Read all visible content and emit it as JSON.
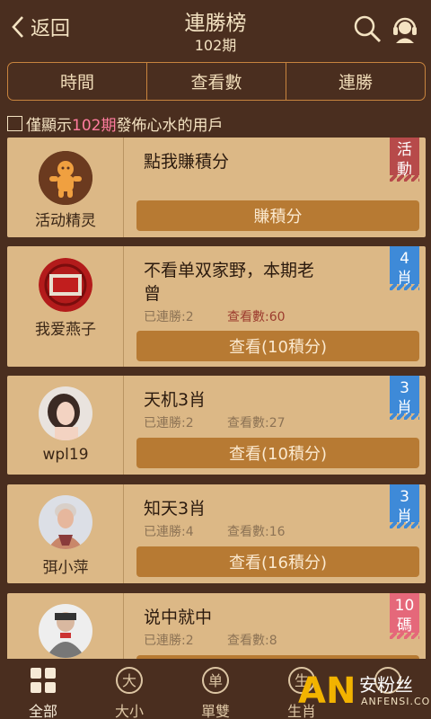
{
  "header": {
    "back_label": "返回",
    "title": "連勝榜",
    "period": "102期"
  },
  "tabs": [
    {
      "label": "時間"
    },
    {
      "label": "查看數"
    },
    {
      "label": "連勝"
    }
  ],
  "filter": {
    "prefix": "僅顯示",
    "period": "102期",
    "suffix": "發佈心水的用戶"
  },
  "cards": [
    {
      "user": "活动精灵",
      "title": "點我賺積分",
      "button": "賺積分",
      "badge": "活\n動",
      "badge_color": "#b74a4a"
    },
    {
      "user": "我爱燕子",
      "title": "不看单双家野，本期老\n曾",
      "wins": "已連勝:2",
      "views": "查看數:60",
      "button": "查看(10積分)",
      "badge": "4\n肖",
      "badge_color": "#3e8ad8"
    },
    {
      "user": "wpl19",
      "title": "天机3肖",
      "wins": "已連勝:2",
      "views": "查看數:27",
      "button": "查看(10積分)",
      "badge": "3\n肖",
      "badge_color": "#3e8ad8"
    },
    {
      "user": "弭小萍",
      "title": "知天3肖",
      "wins": "已連勝:4",
      "views": "查看數:16",
      "button": "查看(16積分)",
      "badge": "3\n肖",
      "badge_color": "#3e8ad8"
    },
    {
      "user": "",
      "title": "说中就中",
      "wins": "已連勝:2",
      "views": "查看數:8",
      "button": "",
      "badge": "10\n碼",
      "badge_color": "#e5687a"
    }
  ],
  "footer": [
    {
      "label": "全部",
      "icon": "grid-icon"
    },
    {
      "label": "大小",
      "icon": "da-icon",
      "glyph": "大"
    },
    {
      "label": "單雙",
      "icon": "shan-icon",
      "glyph": "单"
    },
    {
      "label": "生肖",
      "icon": "zodiac-icon",
      "glyph": "生"
    },
    {
      "label": "",
      "icon": "more-icon",
      "glyph": ""
    }
  ],
  "watermark": {
    "an": "AN",
    "cn": "安粉丝",
    "en": "ANFENSI.COM"
  },
  "colors": {
    "background": "#4a2e1f",
    "card": "#dcb886",
    "button": "#b77a33",
    "highlight": "#ff7c9e"
  }
}
